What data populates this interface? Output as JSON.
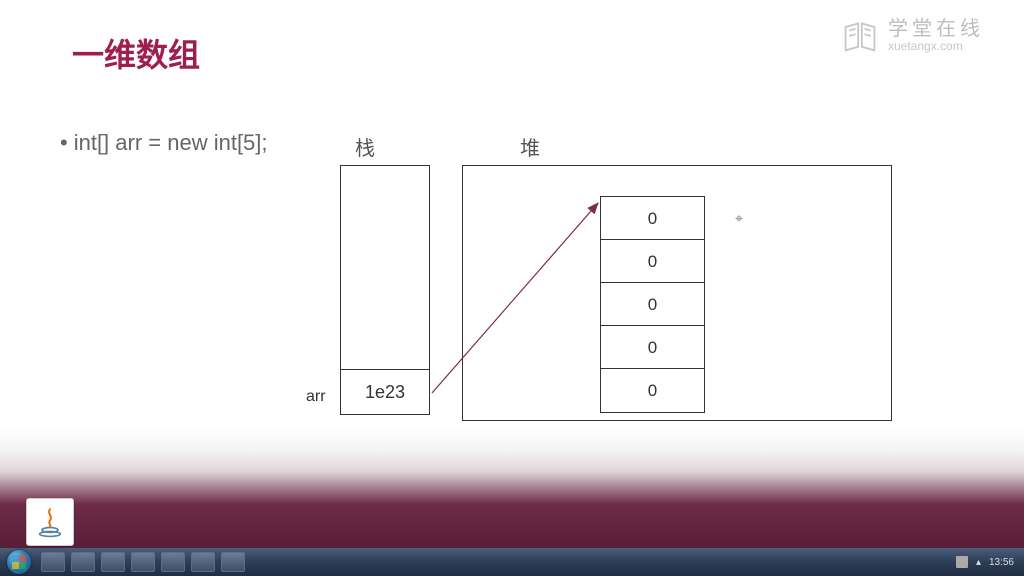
{
  "slide": {
    "title": "一维数组",
    "bullet": "int[] arr = new int[5];",
    "stack_label": "栈",
    "heap_label": "堆",
    "arr_label": "arr",
    "stack_value": "1e23",
    "array_values": [
      "0",
      "0",
      "0",
      "0",
      "0"
    ]
  },
  "watermark": {
    "name_cn": "学堂在线",
    "name_en": "xuetangx.com"
  },
  "taskbar": {
    "time": "13:56"
  }
}
